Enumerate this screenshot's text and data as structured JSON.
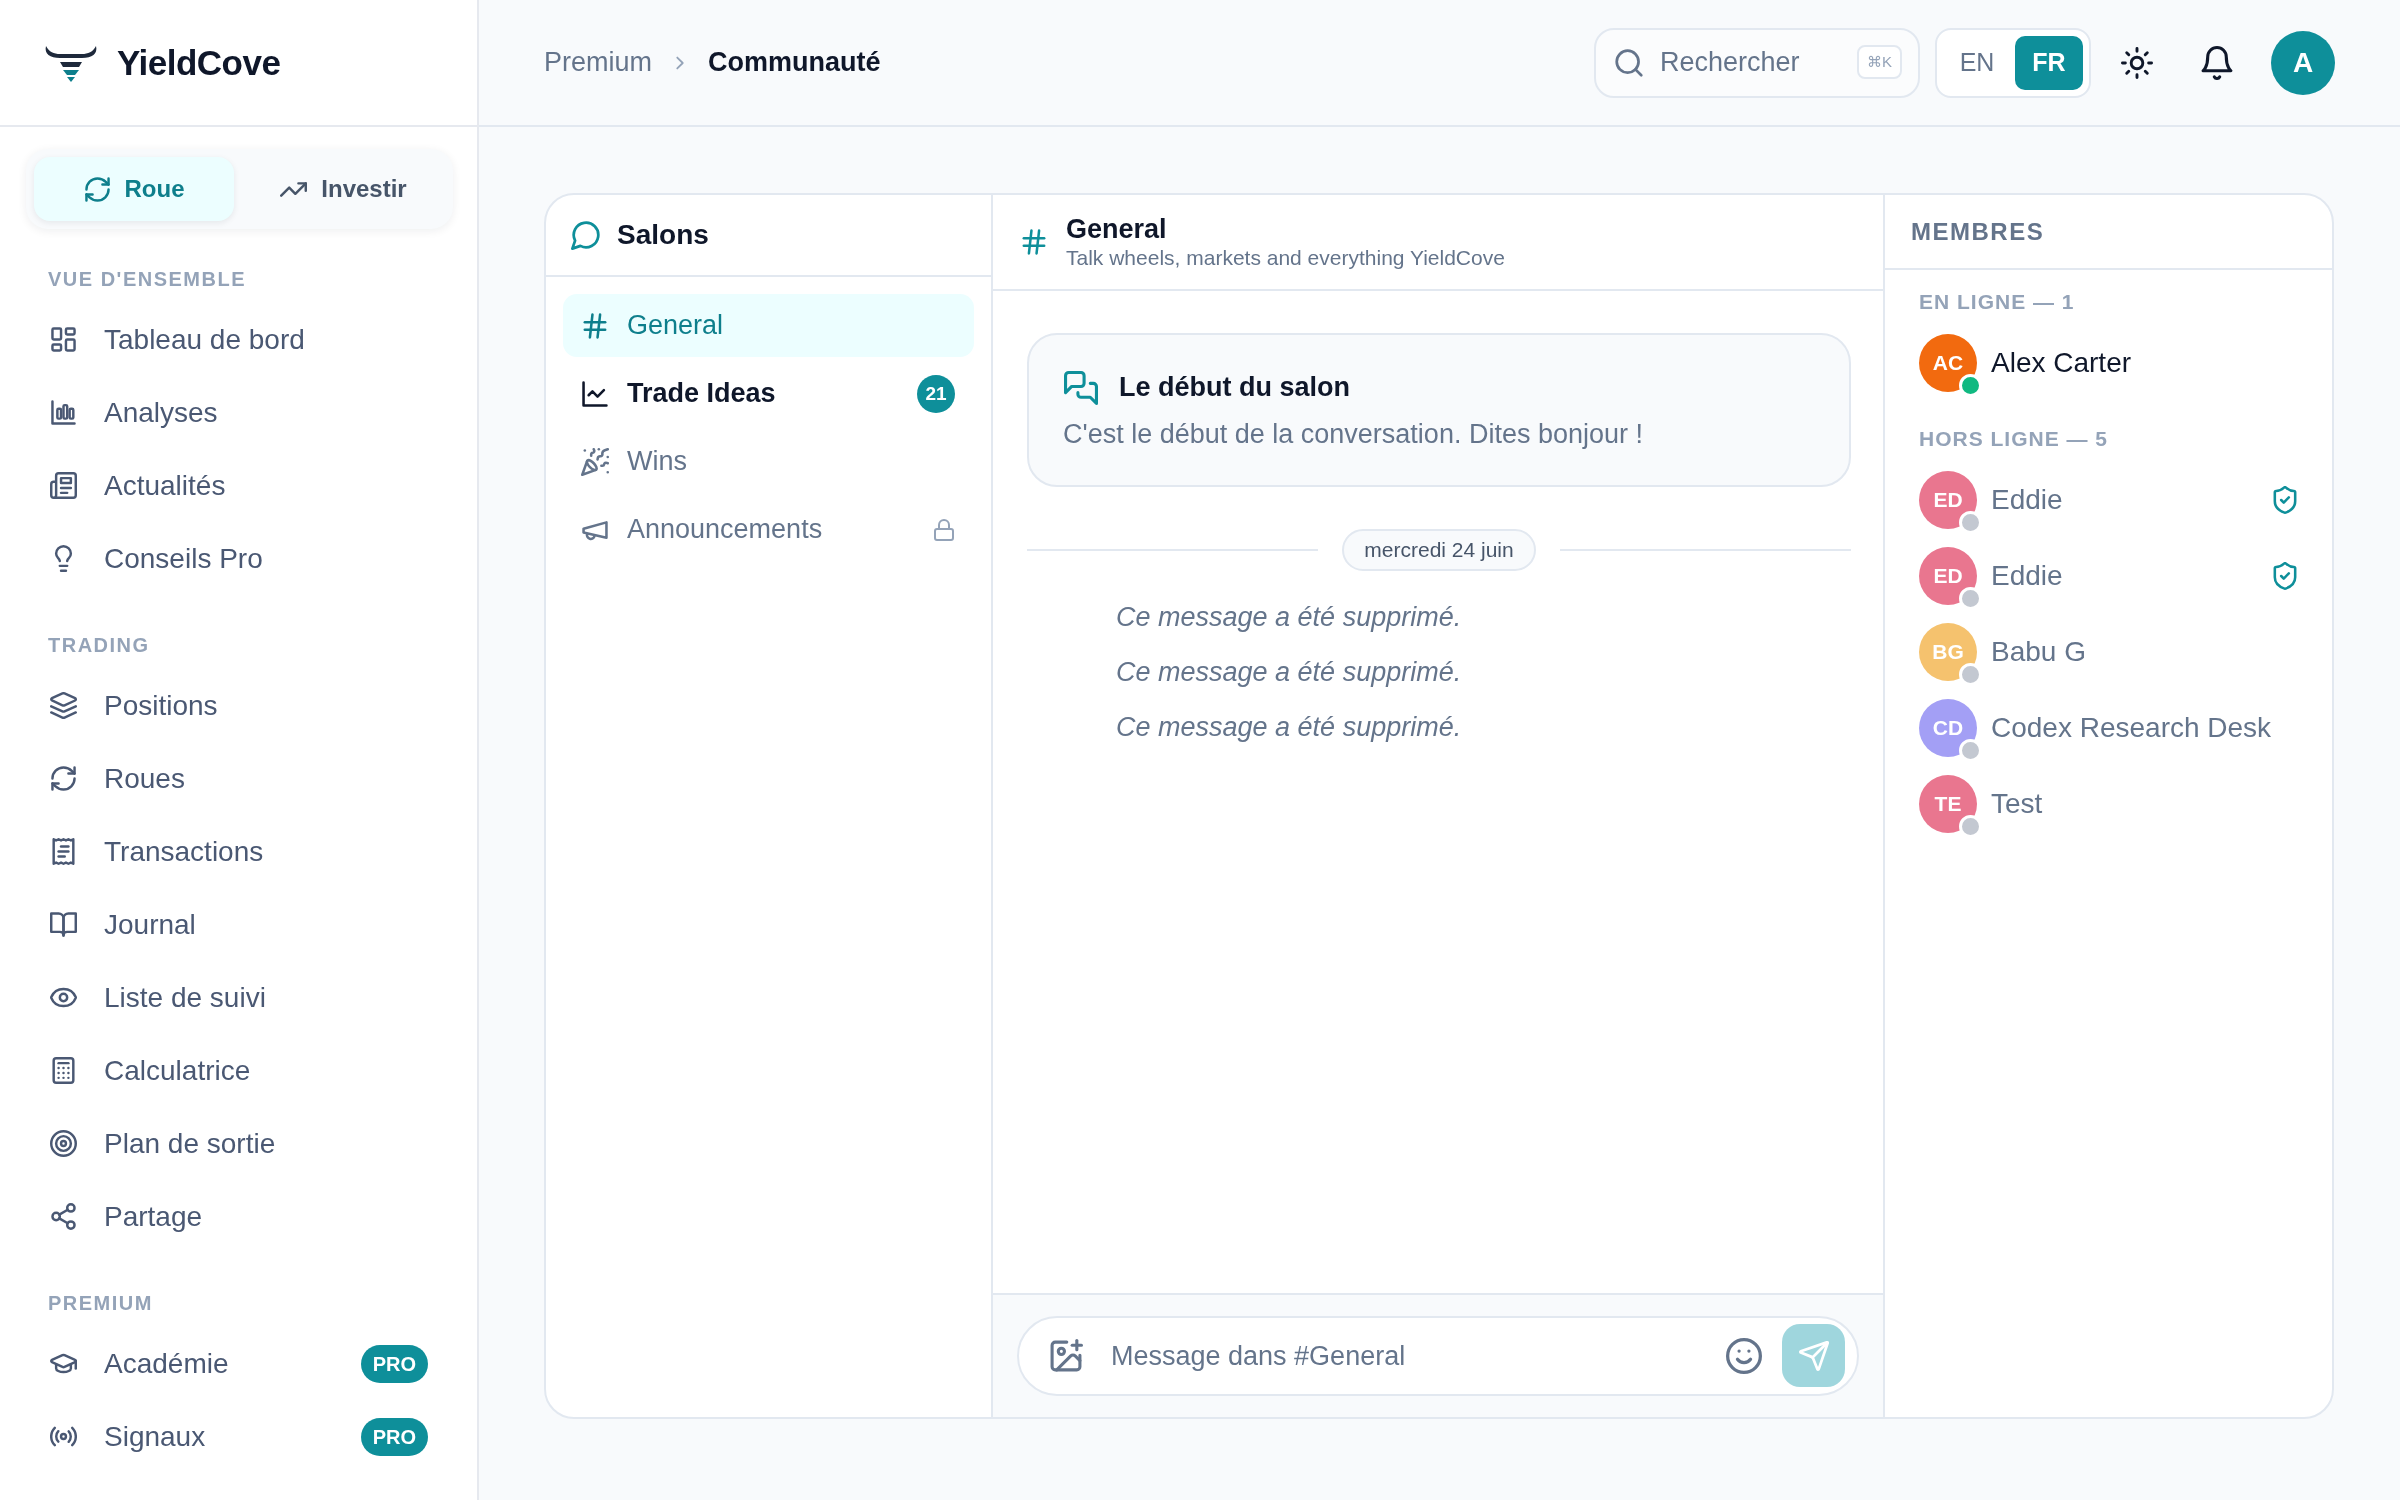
{
  "sidebar": {
    "brand": "YieldCove",
    "mode_tabs": [
      {
        "label": "Roue",
        "selected": true
      },
      {
        "label": "Investir",
        "selected": false
      }
    ],
    "sections": [
      {
        "title": "VUE D'ENSEMBLE",
        "items": [
          {
            "label": "Tableau de bord"
          },
          {
            "label": "Analyses"
          },
          {
            "label": "Actualités"
          },
          {
            "label": "Conseils Pro"
          }
        ]
      },
      {
        "title": "TRADING",
        "items": [
          {
            "label": "Positions"
          },
          {
            "label": "Roues"
          },
          {
            "label": "Transactions"
          },
          {
            "label": "Journal"
          },
          {
            "label": "Liste de suivi"
          },
          {
            "label": "Calculatrice"
          },
          {
            "label": "Plan de sortie"
          },
          {
            "label": "Partage"
          }
        ]
      },
      {
        "title": "PREMIUM",
        "items": [
          {
            "label": "Académie",
            "badge": "PRO"
          },
          {
            "label": "Signaux",
            "badge": "PRO"
          }
        ]
      }
    ]
  },
  "header": {
    "breadcrumb": [
      "Premium",
      "Communauté"
    ],
    "search": {
      "placeholder": "Rechercher",
      "shortcut": "⌘K"
    },
    "languages": [
      {
        "label": "EN",
        "selected": false
      },
      {
        "label": "FR",
        "selected": true
      }
    ],
    "user_avatar": "A"
  },
  "channels": {
    "title": "Salons",
    "items": [
      {
        "name": "General",
        "selected": true,
        "locked": false
      },
      {
        "name": "Trade Ideas",
        "selected": false,
        "locked": false,
        "unread_count": "21"
      },
      {
        "name": "Wins",
        "selected": false,
        "locked": false
      },
      {
        "name": "Announcements",
        "selected": false,
        "locked": true
      }
    ]
  },
  "chat": {
    "title": "General",
    "subtitle": "Talk wheels, markets and everything YieldCove",
    "intro": {
      "title": "Le début du salon",
      "text": "C'est le début de la conversation. Dites bonjour !"
    },
    "date": "mercredi 24 juin",
    "messages": [
      {
        "text": "Ce message a été supprimé.",
        "deleted": true
      },
      {
        "text": "Ce message a été supprimé.",
        "deleted": true
      },
      {
        "text": "Ce message a été supprimé.",
        "deleted": true
      }
    ],
    "composer": {
      "placeholder": "Message dans #General",
      "send_button": {
        "disabled": true
      }
    }
  },
  "members": {
    "title": "MEMBRES",
    "groups": [
      {
        "title": "EN LIGNE — 1",
        "members": [
          {
            "initials": "AC",
            "name": "Alex Carter",
            "color": "#f26a0f",
            "online": true,
            "verified": false
          }
        ]
      },
      {
        "title": "HORS LIGNE — 5",
        "members": [
          {
            "initials": "ED",
            "name": "Eddie",
            "color": "#e9768f",
            "online": false,
            "verified": true
          },
          {
            "initials": "ED",
            "name": "Eddie",
            "color": "#e9768f",
            "online": false,
            "verified": true
          },
          {
            "initials": "BG",
            "name": "Babu G",
            "color": "#f5c26e",
            "online": false,
            "verified": false
          },
          {
            "initials": "CD",
            "name": "Codex Research Desk",
            "color": "#a39ff5",
            "online": false,
            "verified": false
          },
          {
            "initials": "TE",
            "name": "Test",
            "color": "#e9768f",
            "online": false,
            "verified": false
          }
        ]
      }
    ]
  }
}
